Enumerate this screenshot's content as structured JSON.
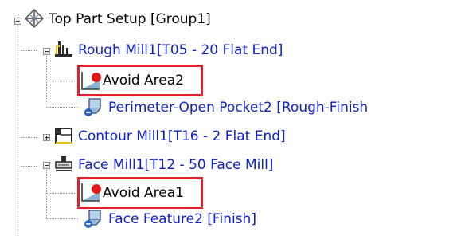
{
  "tree": {
    "root": {
      "label": "Top Part Setup [Group1]",
      "icon": "setup-icon"
    },
    "items": [
      {
        "label": "Rough Mill1[T05 - 20 Flat End]",
        "icon": "rough-mill-icon",
        "color": "#0d21c6"
      },
      {
        "label": "Avoid Area2",
        "icon": "avoid-area-icon",
        "color": "#000000"
      },
      {
        "label": "Perimeter-Open Pocket2 [Rough-Finish",
        "icon": "pocket-feature-icon",
        "color": "#0d21c6"
      },
      {
        "label": "Contour Mill1[T16 - 2 Flat End]",
        "icon": "contour-mill-icon",
        "color": "#0d21c6"
      },
      {
        "label": "Face Mill1[T12 - 50 Face Mill]",
        "icon": "face-mill-icon",
        "color": "#0d21c6"
      },
      {
        "label": "Avoid Area1",
        "icon": "avoid-area-icon",
        "color": "#000000"
      },
      {
        "label": "Face Feature2 [Finish]",
        "icon": "face-feature-icon",
        "color": "#0d21c6"
      }
    ]
  },
  "colors": {
    "highlight": "#e11f2f",
    "link_text": "#0d21c6",
    "tree_lines": "#8a8a8a"
  }
}
